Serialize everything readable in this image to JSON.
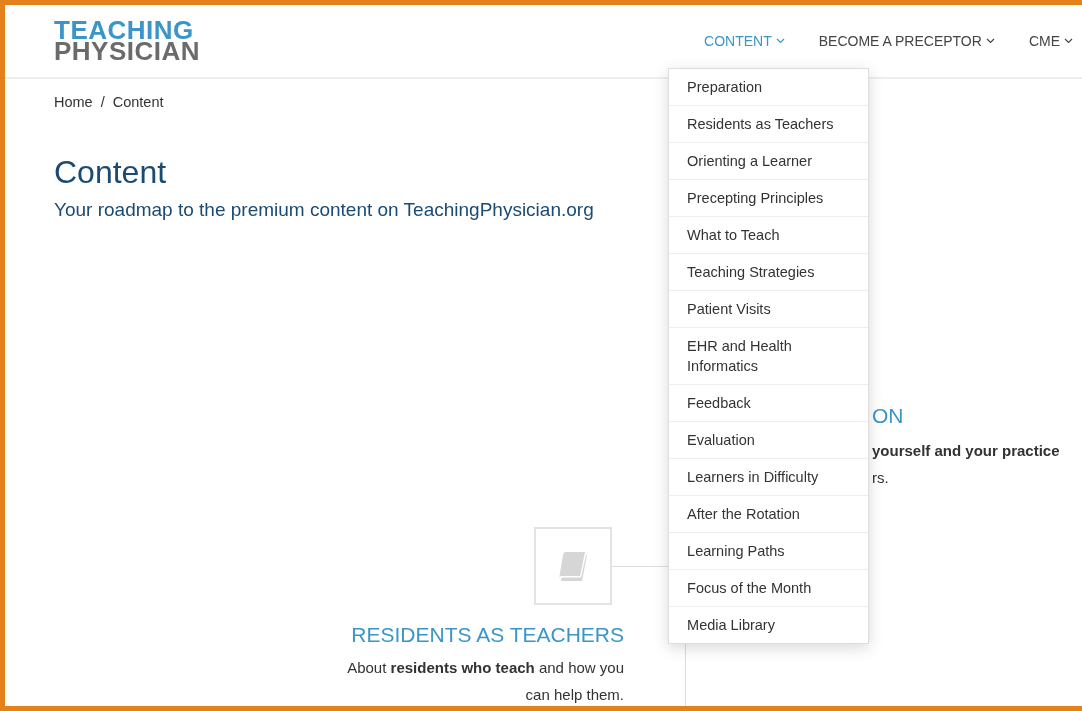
{
  "header": {
    "logo": {
      "line_1": "TEACHING",
      "line_2": "PHYSICIAN"
    },
    "nav": [
      {
        "label": "CONTENT",
        "selected": true,
        "expanded": true,
        "menu": [
          "Preparation",
          "Residents as Teachers",
          "Orienting a Learner",
          "Precepting Principles",
          "What to Teach",
          "Teaching Strategies",
          "Patient Visits",
          "EHR and Health Informatics",
          "Feedback",
          "Evaluation",
          "Learners in Difficulty",
          "After the Rotation",
          "Learning Paths",
          "Focus of the Month",
          "Media Library"
        ]
      },
      {
        "label": "BECOME A PRECEPTOR",
        "selected": false
      },
      {
        "label": "CME",
        "selected": false
      }
    ]
  },
  "breadcrumb": {
    "items": [
      "Home",
      "Content"
    ],
    "separator": "/"
  },
  "page": {
    "title": "Content",
    "subtitle": "Your roadmap to the premium content on TeachingPhysician.org"
  },
  "left_section": {
    "title": "RESIDENTS AS TEACHERS",
    "text": "About **residents who teach** and how you can help them."
  },
  "right_section": {
    "title": "ON",
    "lines": [
      "**yourself and your practice**",
      "rs."
    ]
  }
}
